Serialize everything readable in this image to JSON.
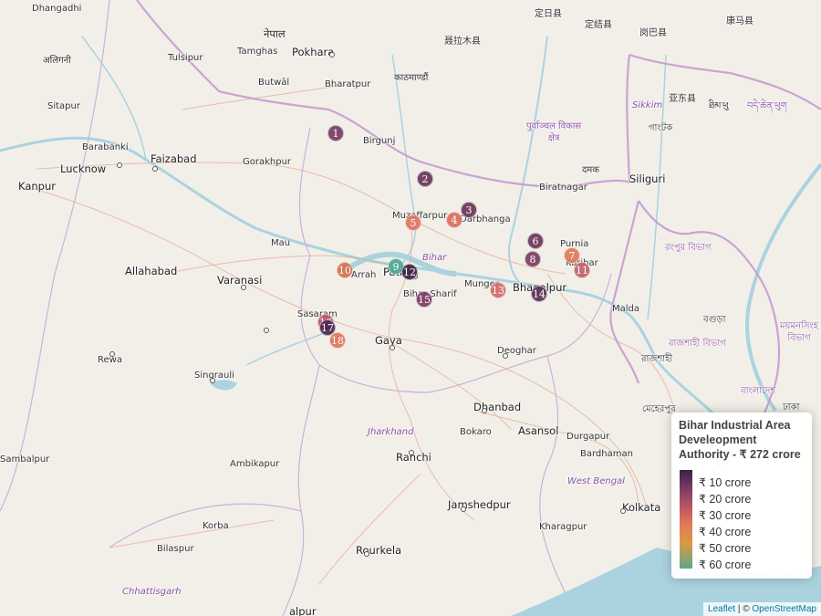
{
  "map": {
    "places": [
      {
        "name": "Dhangadhi",
        "cls": "place"
      },
      {
        "name": "नेपाल",
        "cls": "place city"
      },
      {
        "name": "Pokhara",
        "cls": "place city"
      },
      {
        "name": "Tamghas",
        "cls": "place"
      },
      {
        "name": "Tulsipur",
        "cls": "place"
      },
      {
        "name": "अलिगनी",
        "cls": "place"
      },
      {
        "name": "Butwāl",
        "cls": "place"
      },
      {
        "name": "Bharatpur",
        "cls": "place"
      },
      {
        "name": "काठमाण्डौं",
        "cls": "place"
      },
      {
        "name": "Sitapur",
        "cls": "place"
      },
      {
        "name": "Birgunj",
        "cls": "place"
      },
      {
        "name": "Barabanki",
        "cls": "place"
      },
      {
        "name": "Faizabad",
        "cls": "place city"
      },
      {
        "name": "Gorakhpur",
        "cls": "place"
      },
      {
        "name": "Lucknow",
        "cls": "place city"
      },
      {
        "name": "Kanpur",
        "cls": "place city"
      },
      {
        "name": "Muzaffarpur",
        "cls": "place"
      },
      {
        "name": "Darbhanga",
        "cls": "place"
      },
      {
        "name": "Biratnagar",
        "cls": "place"
      },
      {
        "name": "Siliguri",
        "cls": "place city"
      },
      {
        "name": "Mau",
        "cls": "place"
      },
      {
        "name": "Allahabad",
        "cls": "place city"
      },
      {
        "name": "Varanasi",
        "cls": "place city"
      },
      {
        "name": "Arrah",
        "cls": "place"
      },
      {
        "name": "Patna",
        "cls": "place city"
      },
      {
        "name": "Bihar",
        "cls": "place state"
      },
      {
        "name": "Bihar Sharif",
        "cls": "place"
      },
      {
        "name": "Munger",
        "cls": "place"
      },
      {
        "name": "Bhagalpur",
        "cls": "place city"
      },
      {
        "name": "Purnia",
        "cls": "place"
      },
      {
        "name": "Katihar",
        "cls": "place"
      },
      {
        "name": "Malda",
        "cls": "place"
      },
      {
        "name": "Sasaram",
        "cls": "place"
      },
      {
        "name": "Gaya",
        "cls": "place city"
      },
      {
        "name": "Deoghar",
        "cls": "place"
      },
      {
        "name": "Rewa",
        "cls": "place"
      },
      {
        "name": "Singrauli",
        "cls": "place"
      },
      {
        "name": "Dhanbad",
        "cls": "place city"
      },
      {
        "name": "Bokaro",
        "cls": "place"
      },
      {
        "name": "Asansol",
        "cls": "place city"
      },
      {
        "name": "Durgapur",
        "cls": "place"
      },
      {
        "name": "Bardhaman",
        "cls": "place"
      },
      {
        "name": "Jharkhand",
        "cls": "place state"
      },
      {
        "name": "Ranchi",
        "cls": "place city"
      },
      {
        "name": "West Bengal",
        "cls": "place state"
      },
      {
        "name": "Ambikapur",
        "cls": "place"
      },
      {
        "name": "Jamshedpur",
        "cls": "place city"
      },
      {
        "name": "Kolkata",
        "cls": "place city"
      },
      {
        "name": "Korba",
        "cls": "place"
      },
      {
        "name": "Kharagpur",
        "cls": "place"
      },
      {
        "name": "Bilaspur",
        "cls": "place"
      },
      {
        "name": "Rourkela",
        "cls": "place city"
      },
      {
        "name": "Chhattisgarh",
        "cls": "place state"
      },
      {
        "name": "Sambalpur",
        "cls": "place"
      },
      {
        "name": "alpur",
        "cls": "place city"
      },
      {
        "name": "定日县",
        "cls": "place"
      },
      {
        "name": "定结县",
        "cls": "place"
      },
      {
        "name": "岗巴县",
        "cls": "place"
      },
      {
        "name": "康马县",
        "cls": "place"
      },
      {
        "name": "聂拉木县",
        "cls": "place"
      },
      {
        "name": "亚东县",
        "cls": "place"
      },
      {
        "name": "Sikkim",
        "cls": "place state"
      },
      {
        "name": "গাংটক",
        "cls": "place"
      },
      {
        "name": "ཐིམ་ཕུ",
        "cls": "place"
      },
      {
        "name": "བདེ་ཆེན་ཕུག",
        "cls": "place region"
      },
      {
        "name": "पुर्वाञ्चल विकास\nक्षेत्र",
        "cls": "place region"
      },
      {
        "name": "दमक",
        "cls": "place"
      },
      {
        "name": "রংপুর বিভাগ",
        "cls": "place region"
      },
      {
        "name": "বগুড়া",
        "cls": "place"
      },
      {
        "name": "রাজশাহী বিভাগ",
        "cls": "place region"
      },
      {
        "name": "রাজশাহী",
        "cls": "place"
      },
      {
        "name": "ময়মনসিংহ\nবিভাগ",
        "cls": "place region"
      },
      {
        "name": "বাংলাদেশ",
        "cls": "place region"
      },
      {
        "name": "মেহেরপুর",
        "cls": "place"
      },
      {
        "name": "ঢাকা",
        "cls": "place"
      }
    ],
    "markers": [
      {
        "label": "1",
        "color": "#7a3b62"
      },
      {
        "label": "2",
        "color": "#6a3658"
      },
      {
        "label": "3",
        "color": "#6a3658"
      },
      {
        "label": "4",
        "color": "#d9705c"
      },
      {
        "label": "5",
        "color": "#dd7662"
      },
      {
        "label": "6",
        "color": "#6a3658"
      },
      {
        "label": "7",
        "color": "#df7a5a"
      },
      {
        "label": "8",
        "color": "#7d3d62"
      },
      {
        "label": "9",
        "color": "#4fa892"
      },
      {
        "label": "10",
        "color": "#d2704e"
      },
      {
        "label": "11",
        "color": "#c2616a"
      },
      {
        "label": "12",
        "color": "#3e2147"
      },
      {
        "label": "13",
        "color": "#d4686a"
      },
      {
        "label": "14",
        "color": "#5c2e53"
      },
      {
        "label": "15",
        "color": "#7a3b62"
      },
      {
        "label": "16",
        "color": "#b85468"
      },
      {
        "label": "17",
        "color": "#4a2650"
      },
      {
        "label": "18",
        "color": "#dd745a"
      }
    ]
  },
  "legend": {
    "title": "Bihar Industrial Area Develeopment Authority - ₹ 272 crore",
    "items": [
      "₹ 10 crore",
      "₹ 20 crore",
      "₹ 30 crore",
      "₹ 40 crore",
      "₹ 50 crore",
      "₹ 60 crore"
    ],
    "colors": [
      "#3b1f45",
      "#7a3b62",
      "#c45a62",
      "#e07a56",
      "#d99a45",
      "#5aa88a"
    ]
  },
  "attribution": {
    "leaflet": "Leaflet",
    "separator": " | © ",
    "osm": "OpenStreetMap"
  }
}
